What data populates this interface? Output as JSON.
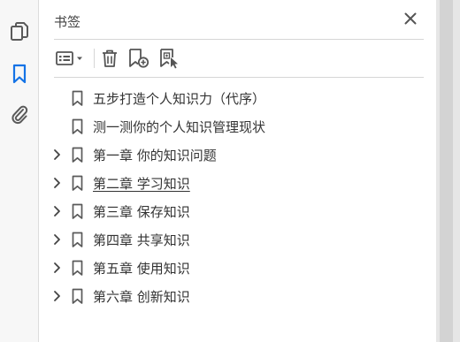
{
  "panel": {
    "title": "书签"
  },
  "toolbar": {
    "options": "options-menu",
    "delete": "delete-bookmark",
    "new": "new-bookmark",
    "from_structure": "new-bookmark-from-structure"
  },
  "bookmarks": [
    {
      "label": "五步打造个人知识力（代序）",
      "expandable": false,
      "underlined": false
    },
    {
      "label": "测一测你的个人知识管理现状",
      "expandable": false,
      "underlined": false
    },
    {
      "label": "第一章  你的知识问题",
      "expandable": true,
      "underlined": false
    },
    {
      "label": "第二章  学习知识",
      "expandable": true,
      "underlined": true
    },
    {
      "label": "第三章  保存知识",
      "expandable": true,
      "underlined": false
    },
    {
      "label": "第四章  共享知识",
      "expandable": true,
      "underlined": false
    },
    {
      "label": "第五章  使用知识",
      "expandable": true,
      "underlined": false
    },
    {
      "label": "第六章  创新知识",
      "expandable": true,
      "underlined": false
    }
  ],
  "colors": {
    "accent": "#1473e6",
    "icon": "#5a5a5a"
  }
}
